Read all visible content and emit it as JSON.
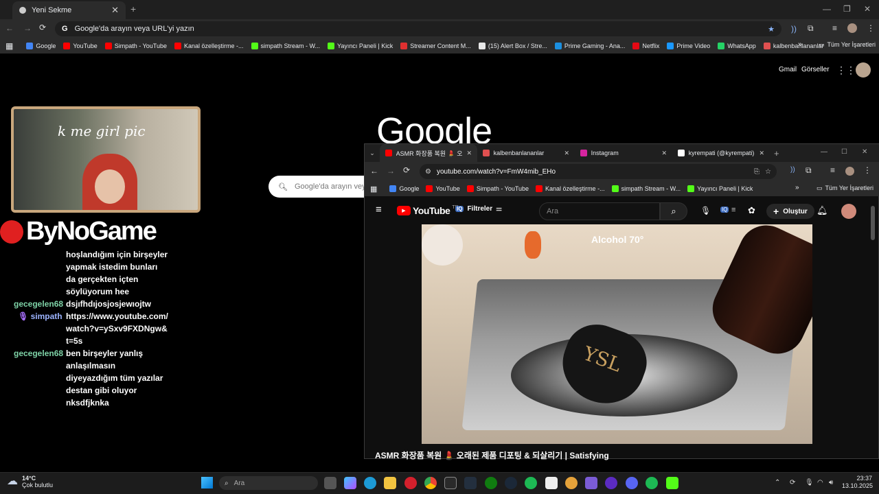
{
  "back_browser": {
    "tab_title": "Yeni Sekme",
    "omnibox_placeholder": "Google'da arayın veya URL'yi yazın",
    "bookmarks": [
      {
        "label": "Google",
        "color": "#4285f4"
      },
      {
        "label": "YouTube",
        "color": "#ff0000"
      },
      {
        "label": "Simpath - YouTube",
        "color": "#ff0000"
      },
      {
        "label": "Kanal özelleştirme -...",
        "color": "#ff0000"
      },
      {
        "label": "simpath Stream - W...",
        "color": "#53fc18"
      },
      {
        "label": "Yayıncı Paneli | Kick",
        "color": "#53fc18"
      },
      {
        "label": "Streamer Content M...",
        "color": "#e03030"
      },
      {
        "label": "(15) Alert Box / Stre...",
        "color": "#e8e8e8"
      },
      {
        "label": "Prime Gaming - Ana...",
        "color": "#1b8fe0"
      },
      {
        "label": "Netflix",
        "color": "#e50914"
      },
      {
        "label": "Prime Video",
        "color": "#1a98ff"
      },
      {
        "label": "WhatsApp",
        "color": "#25d366"
      },
      {
        "label": "kalbenbanlananlar",
        "color": "#e05050"
      }
    ],
    "all_bookmarks": "Tüm Yer İşaretleri"
  },
  "google": {
    "gmail": "Gmail",
    "images": "Görseller",
    "logo": "Google",
    "search_placeholder": "Google'da arayın veya"
  },
  "overlay": {
    "cam_caption": "k me girl pic",
    "brand": "ByNoGame"
  },
  "chat": [
    {
      "user": "",
      "text": "hoşlandığım için birşeyler yapmak istedim bunları da gerçekten içten söylüyorum hee"
    },
    {
      "user": "gecegelen68",
      "text": "dsjıfhdıjosjosjewıojtw"
    },
    {
      "user": "simpath",
      "text": "https://www.youtube.com/watch?v=ySxv9FXDNgw&t=5s"
    },
    {
      "user": "gecegelen68",
      "text": "ben birşeyler yanlış anlaşılmasın diyeyazdığım tüm yazılar destan gibi oluyor nksdfjknka"
    }
  ],
  "front_browser": {
    "tabs": [
      {
        "title": "ASMR 화장품 복원 💄 오래된",
        "color": "#ff0000"
      },
      {
        "title": "kalbenbanlananlar",
        "color": "#e05050"
      },
      {
        "title": "Instagram",
        "color": "#d6249f"
      },
      {
        "title": "kyrempati (@kyrempati) | T",
        "color": "#ffffff"
      }
    ],
    "url": "youtube.com/watch?v=FmW4mib_EHo",
    "bookmarks": [
      {
        "label": "Google",
        "color": "#4285f4"
      },
      {
        "label": "YouTube",
        "color": "#ff0000"
      },
      {
        "label": "Simpath - YouTube",
        "color": "#ff0000"
      },
      {
        "label": "Kanal özelleştirme -...",
        "color": "#ff0000"
      },
      {
        "label": "simpath Stream - W...",
        "color": "#53fc18"
      },
      {
        "label": "Yayıncı Paneli | Kick",
        "color": "#53fc18"
      }
    ],
    "all_bookmarks": "Tüm Yer İşaretleri",
    "youtube": {
      "logo": "YouTube",
      "country": "TR",
      "filters": "Filtreler",
      "search_placeholder": "Ara",
      "create": "Oluştur",
      "video_overlay_text": "Alcohol 70°",
      "video_title": "ASMR 화장품 복원 💄 오래된 제품 디포팅 & 되살리기 | Satisfying"
    }
  },
  "taskbar": {
    "temp": "14°C",
    "weather": "Çok bulutlu",
    "search_placeholder": "Ara",
    "time": "23:37",
    "date": "13.10.2025"
  }
}
